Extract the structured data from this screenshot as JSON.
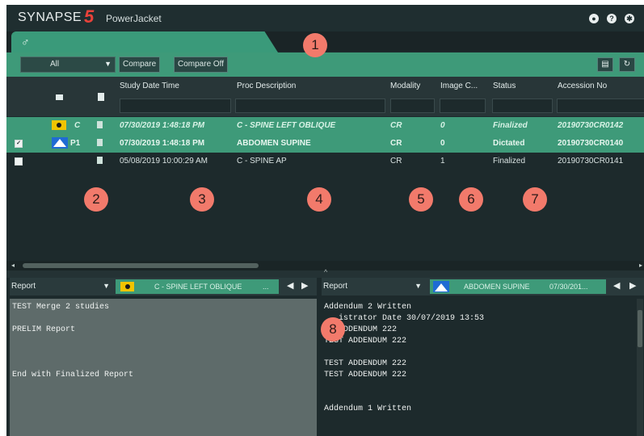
{
  "header": {
    "logo_text": "SYNAPSE",
    "logo_number": "5",
    "product": "PowerJacket",
    "icons": [
      "chat-icon",
      "help-icon",
      "settings-icon"
    ]
  },
  "tab": {
    "icon": "gender-icon"
  },
  "callouts": [
    "1",
    "2",
    "3",
    "4",
    "5",
    "6",
    "7",
    "8"
  ],
  "toolbar": {
    "filter_value": "All",
    "compare_label": "Compare",
    "compare_off_label": "Compare Off"
  },
  "grid": {
    "columns": [
      "Study Date Time",
      "Proc Description",
      "Modality",
      "Image C...",
      "Status",
      "Accession No"
    ],
    "rows": [
      {
        "thumb_label": "C",
        "date": "07/30/2019 1:48:18 PM",
        "proc": "C - SPINE LEFT OBLIQUE",
        "modality": "CR",
        "images": "0",
        "status": "Finalized",
        "accession": "20190730CR0142"
      },
      {
        "thumb_label": "P1",
        "date": "07/30/2019 1:48:18 PM",
        "proc": "ABDOMEN SUPINE",
        "modality": "CR",
        "images": "0",
        "status": "Dictated",
        "accession": "20190730CR0140"
      },
      {
        "thumb_label": "",
        "date": "05/08/2019 10:00:29 AM",
        "proc": "C - SPINE AP",
        "modality": "CR",
        "images": "1",
        "status": "Finalized",
        "accession": "20190730CR0141"
      }
    ]
  },
  "left_panel": {
    "select": "Report",
    "study": "C - SPINE LEFT OBLIQUE",
    "study_suffix": "...",
    "lines": [
      "TEST Merge 2 studies",
      "",
      "PRELIM Report",
      "",
      "",
      "",
      "End with Finalized Report"
    ]
  },
  "right_panel": {
    "select": "Report",
    "study": "ABDOMEN SUPINE",
    "study_date": "07/30/201...",
    "lines": [
      "Addendum 2 Written",
      "   istrator Date 30/07/2019 13:53",
      "   ADDENDUM 222",
      "TEST ADDENDUM 222",
      "",
      "TEST ADDENDUM 222",
      "TEST ADDENDUM 222",
      "",
      "",
      "Addendum 1 Written"
    ]
  },
  "colors": {
    "accent": "#3e9a79",
    "background": "#1d2a2c",
    "callout": "#f27a6b",
    "logo_red": "#e8423a"
  }
}
